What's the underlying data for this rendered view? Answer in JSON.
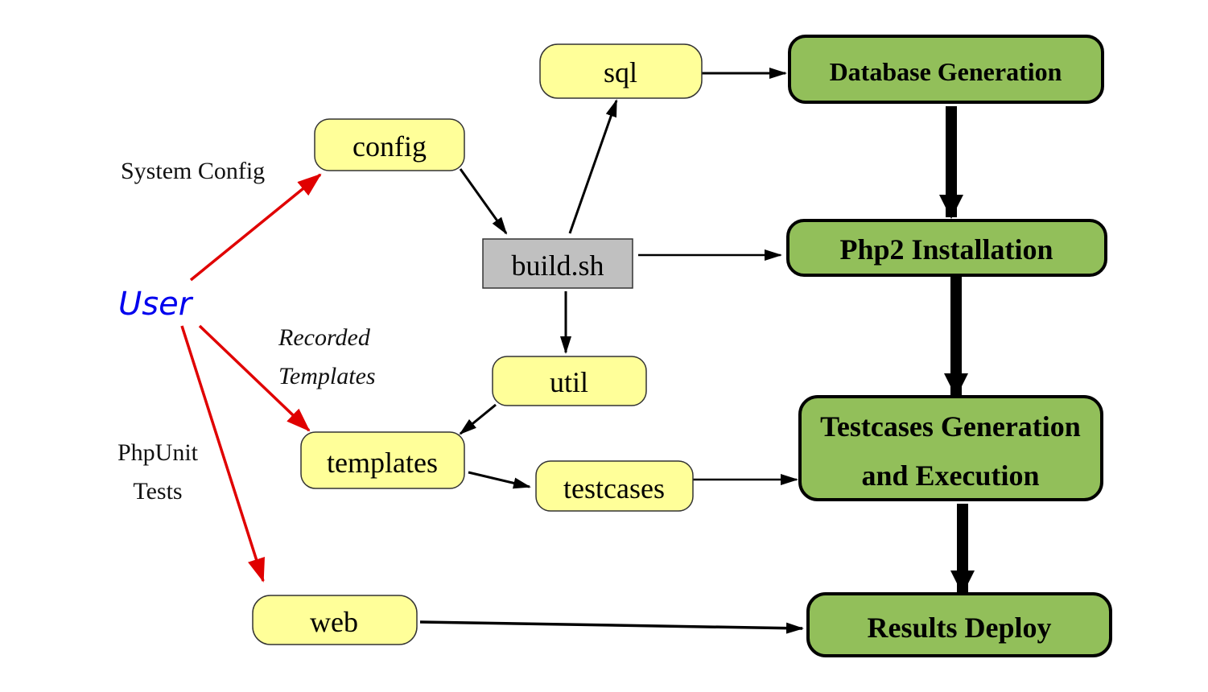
{
  "colors": {
    "yellow_fill": "#ffff99",
    "green_fill": "#92bf5a",
    "gray_fill": "#c0c0c0",
    "red_arrow": "#e00000",
    "user_blue": "#0000ee",
    "black": "#000000"
  },
  "actor": {
    "label": "User"
  },
  "edge_labels": {
    "system_config": "System Config",
    "recorded_line1": "Recorded",
    "recorded_line2": "Templates",
    "phpunit_line1": "PhpUnit",
    "phpunit_line2": "Tests"
  },
  "nodes": {
    "config": "config",
    "sql": "sql",
    "build": "build.sh",
    "util": "util",
    "templates": "templates",
    "testcases": "testcases",
    "web": "web"
  },
  "stages": {
    "database_generation": "Database Generation",
    "php2_installation": "Php2 Installation",
    "testcases_line1": "Testcases Generation",
    "testcases_line2": "and Execution",
    "results_deploy": "Results Deploy"
  },
  "edges": [
    {
      "from": "User",
      "to": "config",
      "style": "red"
    },
    {
      "from": "User",
      "to": "templates",
      "style": "red"
    },
    {
      "from": "User",
      "to": "web",
      "style": "red"
    },
    {
      "from": "config",
      "to": "build.sh",
      "style": "black"
    },
    {
      "from": "build.sh",
      "to": "sql",
      "style": "black"
    },
    {
      "from": "build.sh",
      "to": "util",
      "style": "black"
    },
    {
      "from": "build.sh",
      "to": "Php2 Installation",
      "style": "black"
    },
    {
      "from": "sql",
      "to": "Database Generation",
      "style": "black"
    },
    {
      "from": "util",
      "to": "templates",
      "style": "black"
    },
    {
      "from": "templates",
      "to": "testcases",
      "style": "black"
    },
    {
      "from": "testcases",
      "to": "Testcases Generation and Execution",
      "style": "black"
    },
    {
      "from": "web",
      "to": "Results Deploy",
      "style": "black"
    },
    {
      "from": "Database Generation",
      "to": "Php2 Installation",
      "style": "thick"
    },
    {
      "from": "Php2 Installation",
      "to": "Testcases Generation and Execution",
      "style": "thick"
    },
    {
      "from": "Testcases Generation and Execution",
      "to": "Results Deploy",
      "style": "thick"
    }
  ]
}
